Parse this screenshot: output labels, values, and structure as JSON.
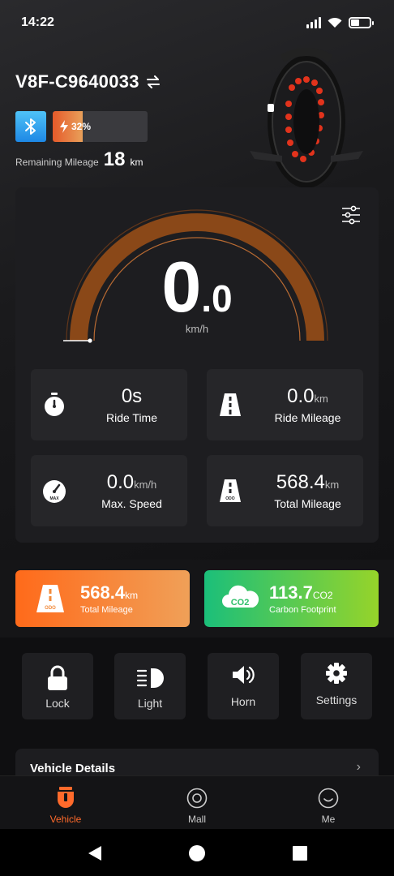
{
  "status_bar": {
    "time": "14:22"
  },
  "device": {
    "name": "V8F-C9640033"
  },
  "battery": {
    "percent_text": "32%",
    "level": 0.32
  },
  "remaining": {
    "label": "Remaining Mileage",
    "value": "18",
    "unit": "km"
  },
  "speedometer": {
    "integer": "0",
    "decimal": ".0",
    "unit": "km/h"
  },
  "stats": [
    {
      "value": "0s",
      "unit": "",
      "label": "Ride Time",
      "icon": "stopwatch-icon"
    },
    {
      "value": "0.0",
      "unit": "km",
      "label": "Ride Mileage",
      "icon": "road-icon"
    },
    {
      "value": "0.0",
      "unit": "km/h",
      "label": "Max. Speed",
      "icon": "speedometer-max-icon"
    },
    {
      "value": "568.4",
      "unit": "km",
      "label": "Total Mileage",
      "icon": "road-odo-icon"
    }
  ],
  "summary": {
    "mileage": {
      "value": "568.4",
      "unit": "km",
      "label": "Total Mileage",
      "color_start": "#ff6a1a",
      "color_end": "#f0a058"
    },
    "carbon": {
      "value": "113.7",
      "unit": "CO2",
      "label": "Carbon Footprint",
      "color_start": "#1bbf7a",
      "color_end": "#96d42a"
    }
  },
  "controls": [
    {
      "label": "Lock",
      "icon": "lock-icon"
    },
    {
      "label": "Light",
      "icon": "headlight-icon"
    },
    {
      "label": "Horn",
      "icon": "horn-icon"
    },
    {
      "label": "Settings",
      "icon": "gear-icon"
    }
  ],
  "vehicle_details": {
    "title": "Vehicle Details"
  },
  "tabs": [
    {
      "label": "Vehicle",
      "active": true,
      "icon": "vehicle-icon"
    },
    {
      "label": "Mall",
      "active": false,
      "icon": "mall-icon"
    },
    {
      "label": "Me",
      "active": false,
      "icon": "me-icon"
    }
  ],
  "accent_color": "#ff6a2b"
}
